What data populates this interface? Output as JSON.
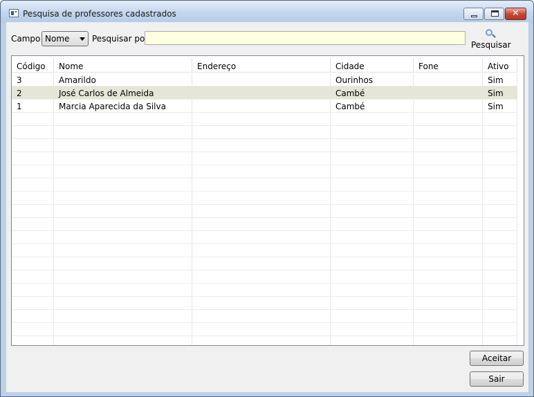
{
  "window": {
    "title": "Pesquisa de professores cadastrados"
  },
  "search": {
    "campo_label": "Campo",
    "campo_value": "Nome",
    "pesquisar_por_label": "Pesquisar por",
    "input_value": "",
    "button_label": "Pesquisar"
  },
  "table": {
    "columns": [
      "Código",
      "Nome",
      "Endereço",
      "Cidade",
      "Fone",
      "Ativo"
    ],
    "rows": [
      {
        "codigo": "3",
        "nome": "Amarildo",
        "endereco": "",
        "cidade": "Ourinhos",
        "fone": "",
        "ativo": "Sim"
      },
      {
        "codigo": "2",
        "nome": "José Carlos de Almeida",
        "endereco": "",
        "cidade": "Cambé",
        "fone": "",
        "ativo": "Sim"
      },
      {
        "codigo": "1",
        "nome": "Marcia Aparecida da Silva",
        "endereco": "",
        "cidade": "Cambé",
        "fone": "",
        "ativo": "Sim"
      }
    ]
  },
  "buttons": {
    "aceitar": "Aceitar",
    "sair": "Sair"
  },
  "colors": {
    "selected_row": "#e5e5d8",
    "input_bg": "#ffffe1"
  }
}
